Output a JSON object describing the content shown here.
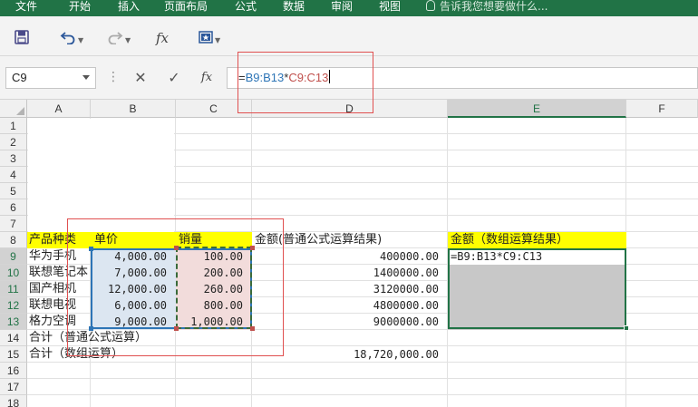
{
  "ribbon": {
    "tabs": [
      {
        "label": "文件"
      },
      {
        "label": "开始"
      },
      {
        "label": "插入"
      },
      {
        "label": "页面布局"
      },
      {
        "label": "公式"
      },
      {
        "label": "数据"
      },
      {
        "label": "审阅"
      },
      {
        "label": "视图"
      }
    ],
    "tell_me": "告诉我您想要做什么...",
    "theme_color": "#217346"
  },
  "quick_access": {
    "icons": [
      "save-icon",
      "undo-icon",
      "redo-icon",
      "insert-function-icon",
      "custom-toolbar-icon"
    ],
    "fx": "fx"
  },
  "formula_bar": {
    "name_box": "C9",
    "fx": "fx",
    "cancel": "✕",
    "enter": "✓",
    "formula": {
      "eq": "=",
      "ref1": "B9:B13",
      "op": "*",
      "ref2": "C9:C13"
    }
  },
  "columns": [
    "A",
    "B",
    "C",
    "D",
    "E",
    "F"
  ],
  "rows": [
    "1",
    "2",
    "3",
    "4",
    "5",
    "6",
    "7",
    "8",
    "9",
    "10",
    "11",
    "12",
    "13",
    "14",
    "15",
    "16",
    "17",
    "18"
  ],
  "sheet": {
    "header_row": {
      "product": "产品种类",
      "price": "单价",
      "qty": "销量",
      "amount_normal": "金额(普通公式运算结果)",
      "amount_array": "金额（数组运算结果）"
    },
    "items": [
      {
        "name": "华为手机",
        "price": "4,000.00",
        "qty": "100.00",
        "amount": "400000.00"
      },
      {
        "name": "联想笔记本",
        "price": "7,000.00",
        "qty": "200.00",
        "amount": "1400000.00"
      },
      {
        "name": "国产相机",
        "price": "12,000.00",
        "qty": "260.00",
        "amount": "3120000.00"
      },
      {
        "name": "联想电视",
        "price": "6,000.00",
        "qty": "800.00",
        "amount": "4800000.00"
      },
      {
        "name": "格力空调",
        "price": "9,000.00",
        "qty": "1,000.00",
        "amount": "9000000.00"
      }
    ],
    "e9_formula": "=B9:B13*C9:C13",
    "total_normal_label": "合计（普通公式运算）",
    "total_array_label": "合计（数组运算）",
    "total_array_value": "18,720,000.00"
  }
}
